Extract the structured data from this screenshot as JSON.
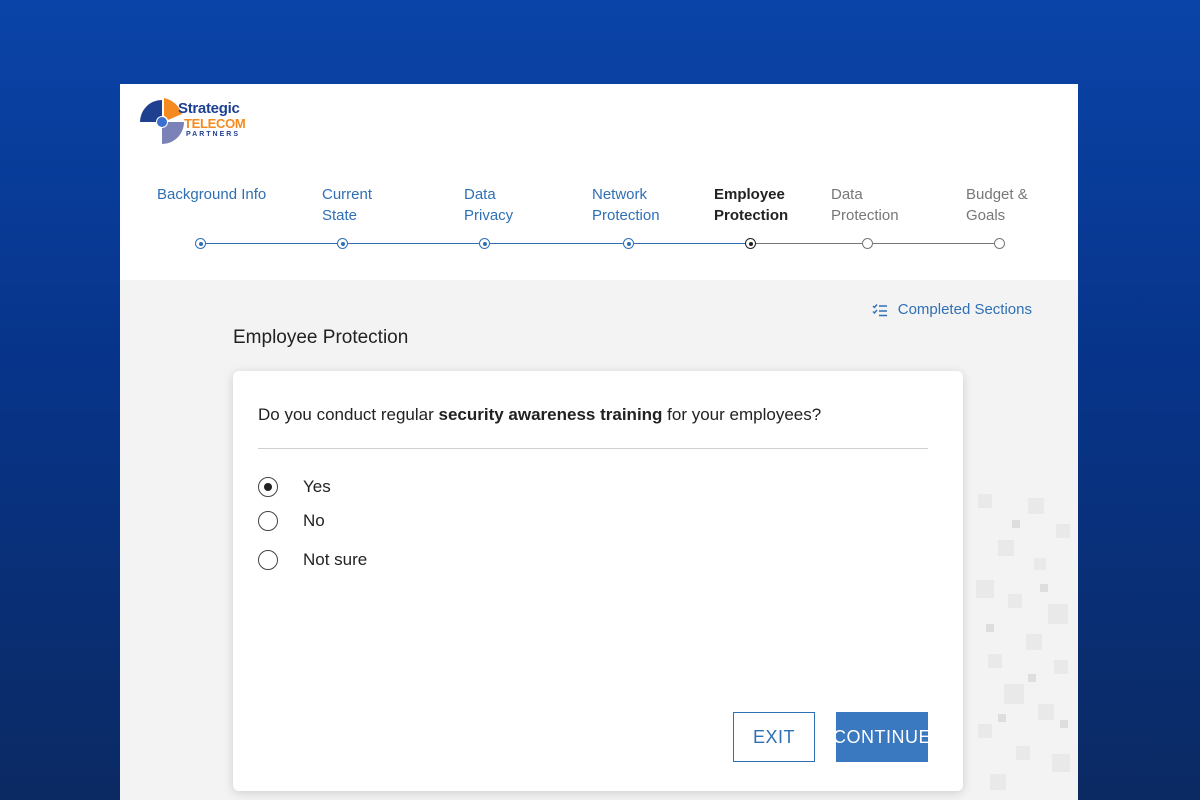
{
  "brand": {
    "word1": "Strategic",
    "word2": "TELECOM",
    "word3": "PARTNERS",
    "colors": {
      "blue": "#1f3f8f",
      "orange": "#f58a1f"
    }
  },
  "steps": [
    {
      "label": "Background Info",
      "state": "done"
    },
    {
      "label": "Current State",
      "state": "done"
    },
    {
      "label": "Data Privacy",
      "state": "done"
    },
    {
      "label": "Network Protection",
      "state": "done"
    },
    {
      "label": "Employee Protection",
      "state": "active"
    },
    {
      "label": "Data Protection",
      "state": "todo"
    },
    {
      "label": "Budget & Goals",
      "state": "todo"
    }
  ],
  "completed_sections": {
    "label": "Completed Sections",
    "icon": "checklist-icon"
  },
  "section_title": "Employee Protection",
  "question": {
    "prefix": "Do you conduct regular ",
    "emphasis": "security awareness training",
    "suffix": " for your employees?"
  },
  "options": [
    {
      "label": "Yes",
      "checked": true
    },
    {
      "label": "No",
      "checked": false
    },
    {
      "label": "Not sure",
      "checked": false
    }
  ],
  "buttons": {
    "exit": "EXIT",
    "continue": "CONTINUE"
  },
  "colors": {
    "accent": "#2f6fb5",
    "button": "#3a78bf",
    "background_top": "#0a44a8"
  }
}
